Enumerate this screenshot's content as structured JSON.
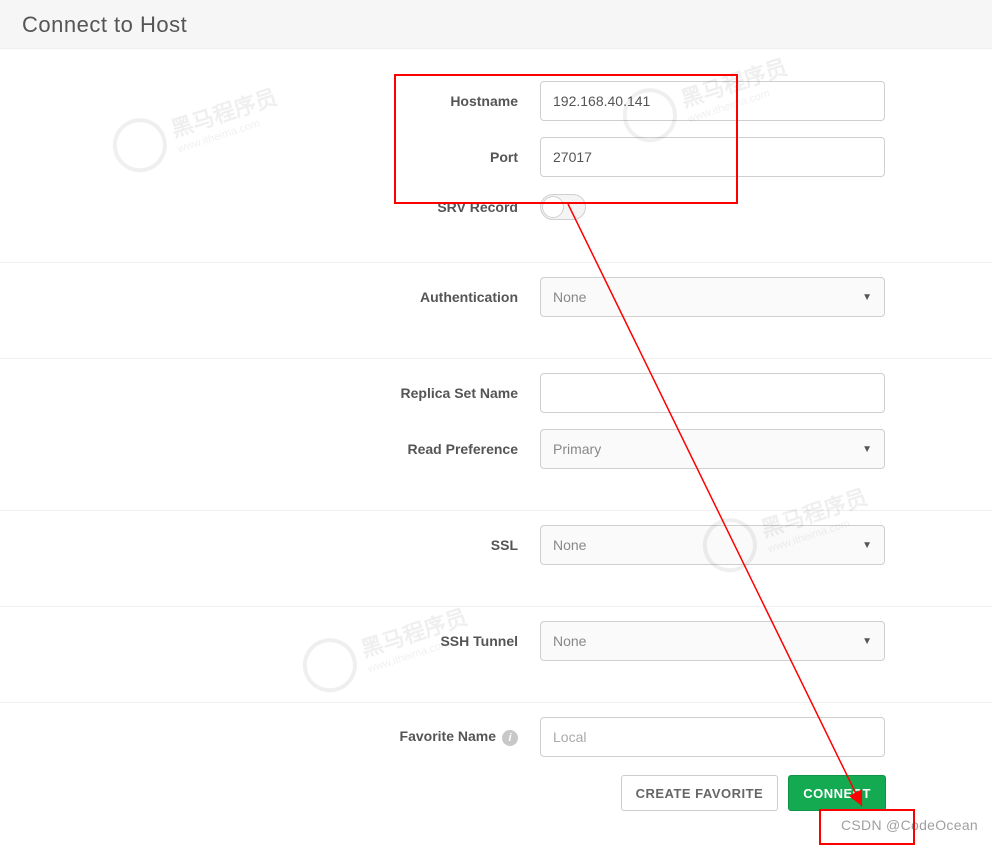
{
  "header": {
    "title": "Connect to Host"
  },
  "fields": {
    "hostname": {
      "label": "Hostname",
      "value": "192.168.40.141"
    },
    "port": {
      "label": "Port",
      "value": "27017"
    },
    "srv": {
      "label": "SRV Record",
      "on": false
    },
    "auth": {
      "label": "Authentication",
      "value": "None"
    },
    "replica": {
      "label": "Replica Set Name",
      "value": ""
    },
    "readpref": {
      "label": "Read Preference",
      "value": "Primary"
    },
    "ssl": {
      "label": "SSL",
      "value": "None"
    },
    "ssh": {
      "label": "SSH Tunnel",
      "value": "None"
    },
    "favorite": {
      "label": "Favorite Name",
      "placeholder": "Local",
      "value": ""
    }
  },
  "buttons": {
    "create_favorite": "CREATE FAVORITE",
    "connect": "CONNECT"
  },
  "annotations": {
    "highlight_hostname_port": true,
    "highlight_connect": true,
    "arrow_from_hostname_to_connect": true
  },
  "watermark": {
    "bottom_right": "CSDN @CodeOcean",
    "bg_text": "黑马程序员",
    "bg_sub": "www.itheima.com"
  }
}
